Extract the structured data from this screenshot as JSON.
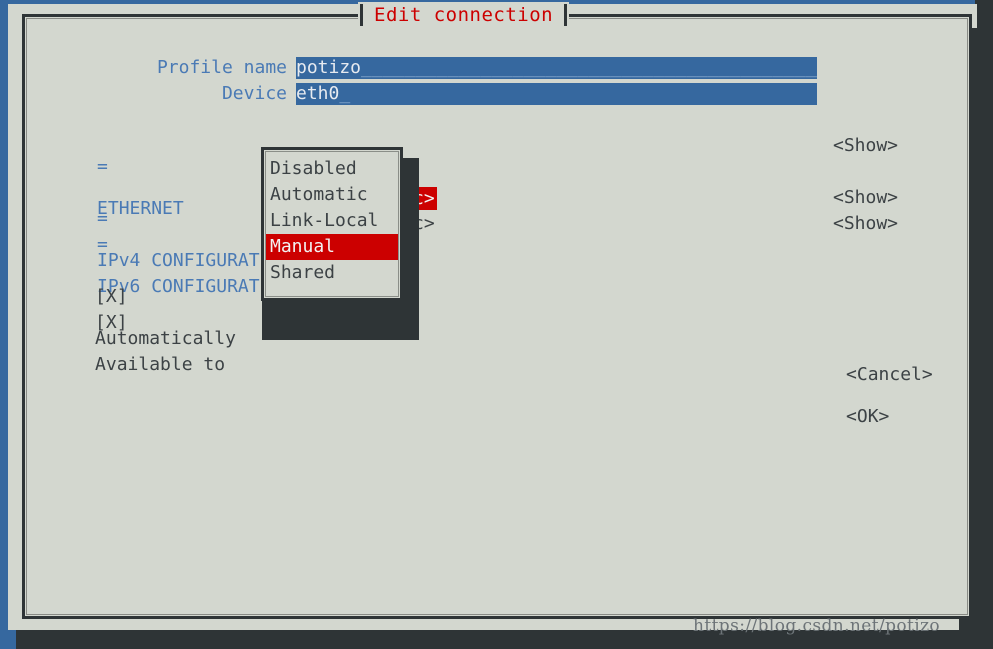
{
  "window": {
    "title": "Edit connection",
    "accent_color": "#36689f",
    "title_color": "#cc0000",
    "body_color": "#d3d7cf",
    "frame_color": "#2e3436"
  },
  "form": {
    "fields": [
      {
        "label": "Profile name",
        "value": "potizo",
        "fill": "________________________________________________"
      },
      {
        "label": "Device",
        "value": "eth0",
        "fill": "_"
      }
    ]
  },
  "sections": [
    {
      "marker": "=",
      "label": "ETHERNET",
      "show_label": "<Show>"
    },
    {
      "marker": "=",
      "label": "IPv4 CONFIGURAT",
      "show_label": "<Show>"
    },
    {
      "marker": "=",
      "label": "IPv6 CONFIGURAT",
      "show_label": "<Show>"
    }
  ],
  "peeking_values": [
    {
      "text": "c>",
      "selected": true
    },
    {
      "text": "c>",
      "selected": false
    }
  ],
  "checkboxes": [
    {
      "box": "[X]",
      "label": "Automatically"
    },
    {
      "box": "[X]",
      "label": "Available to"
    }
  ],
  "dropdown": {
    "items": [
      {
        "label": "Disabled",
        "selected": false
      },
      {
        "label": "Automatic",
        "selected": false
      },
      {
        "label": "Link-Local",
        "selected": false
      },
      {
        "label": "Manual",
        "selected": true
      },
      {
        "label": "Shared",
        "selected": false
      }
    ],
    "highlight_color": "#cc0000"
  },
  "buttons": {
    "cancel": "<Cancel>",
    "ok": "<OK>",
    "pair": "<Cancel> <OK>"
  },
  "watermark": "https://blog.csdn.net/potizo"
}
